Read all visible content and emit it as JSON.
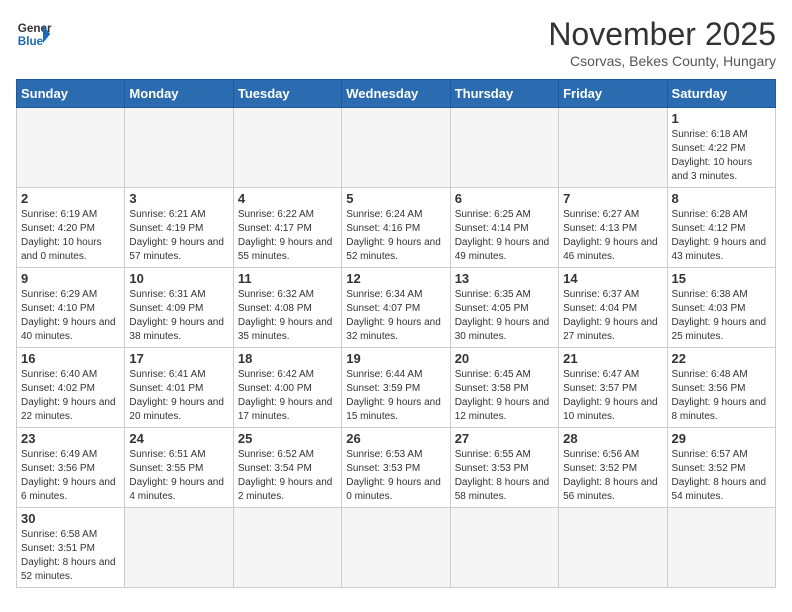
{
  "logo": {
    "text_general": "General",
    "text_blue": "Blue"
  },
  "title": "November 2025",
  "subtitle": "Csorvas, Bekes County, Hungary",
  "weekdays": [
    "Sunday",
    "Monday",
    "Tuesday",
    "Wednesday",
    "Thursday",
    "Friday",
    "Saturday"
  ],
  "weeks": [
    [
      {
        "day": "",
        "info": ""
      },
      {
        "day": "",
        "info": ""
      },
      {
        "day": "",
        "info": ""
      },
      {
        "day": "",
        "info": ""
      },
      {
        "day": "",
        "info": ""
      },
      {
        "day": "",
        "info": ""
      },
      {
        "day": "1",
        "info": "Sunrise: 6:18 AM\nSunset: 4:22 PM\nDaylight: 10 hours and 3 minutes."
      }
    ],
    [
      {
        "day": "2",
        "info": "Sunrise: 6:19 AM\nSunset: 4:20 PM\nDaylight: 10 hours and 0 minutes."
      },
      {
        "day": "3",
        "info": "Sunrise: 6:21 AM\nSunset: 4:19 PM\nDaylight: 9 hours and 57 minutes."
      },
      {
        "day": "4",
        "info": "Sunrise: 6:22 AM\nSunset: 4:17 PM\nDaylight: 9 hours and 55 minutes."
      },
      {
        "day": "5",
        "info": "Sunrise: 6:24 AM\nSunset: 4:16 PM\nDaylight: 9 hours and 52 minutes."
      },
      {
        "day": "6",
        "info": "Sunrise: 6:25 AM\nSunset: 4:14 PM\nDaylight: 9 hours and 49 minutes."
      },
      {
        "day": "7",
        "info": "Sunrise: 6:27 AM\nSunset: 4:13 PM\nDaylight: 9 hours and 46 minutes."
      },
      {
        "day": "8",
        "info": "Sunrise: 6:28 AM\nSunset: 4:12 PM\nDaylight: 9 hours and 43 minutes."
      }
    ],
    [
      {
        "day": "9",
        "info": "Sunrise: 6:29 AM\nSunset: 4:10 PM\nDaylight: 9 hours and 40 minutes."
      },
      {
        "day": "10",
        "info": "Sunrise: 6:31 AM\nSunset: 4:09 PM\nDaylight: 9 hours and 38 minutes."
      },
      {
        "day": "11",
        "info": "Sunrise: 6:32 AM\nSunset: 4:08 PM\nDaylight: 9 hours and 35 minutes."
      },
      {
        "day": "12",
        "info": "Sunrise: 6:34 AM\nSunset: 4:07 PM\nDaylight: 9 hours and 32 minutes."
      },
      {
        "day": "13",
        "info": "Sunrise: 6:35 AM\nSunset: 4:05 PM\nDaylight: 9 hours and 30 minutes."
      },
      {
        "day": "14",
        "info": "Sunrise: 6:37 AM\nSunset: 4:04 PM\nDaylight: 9 hours and 27 minutes."
      },
      {
        "day": "15",
        "info": "Sunrise: 6:38 AM\nSunset: 4:03 PM\nDaylight: 9 hours and 25 minutes."
      }
    ],
    [
      {
        "day": "16",
        "info": "Sunrise: 6:40 AM\nSunset: 4:02 PM\nDaylight: 9 hours and 22 minutes."
      },
      {
        "day": "17",
        "info": "Sunrise: 6:41 AM\nSunset: 4:01 PM\nDaylight: 9 hours and 20 minutes."
      },
      {
        "day": "18",
        "info": "Sunrise: 6:42 AM\nSunset: 4:00 PM\nDaylight: 9 hours and 17 minutes."
      },
      {
        "day": "19",
        "info": "Sunrise: 6:44 AM\nSunset: 3:59 PM\nDaylight: 9 hours and 15 minutes."
      },
      {
        "day": "20",
        "info": "Sunrise: 6:45 AM\nSunset: 3:58 PM\nDaylight: 9 hours and 12 minutes."
      },
      {
        "day": "21",
        "info": "Sunrise: 6:47 AM\nSunset: 3:57 PM\nDaylight: 9 hours and 10 minutes."
      },
      {
        "day": "22",
        "info": "Sunrise: 6:48 AM\nSunset: 3:56 PM\nDaylight: 9 hours and 8 minutes."
      }
    ],
    [
      {
        "day": "23",
        "info": "Sunrise: 6:49 AM\nSunset: 3:56 PM\nDaylight: 9 hours and 6 minutes."
      },
      {
        "day": "24",
        "info": "Sunrise: 6:51 AM\nSunset: 3:55 PM\nDaylight: 9 hours and 4 minutes."
      },
      {
        "day": "25",
        "info": "Sunrise: 6:52 AM\nSunset: 3:54 PM\nDaylight: 9 hours and 2 minutes."
      },
      {
        "day": "26",
        "info": "Sunrise: 6:53 AM\nSunset: 3:53 PM\nDaylight: 9 hours and 0 minutes."
      },
      {
        "day": "27",
        "info": "Sunrise: 6:55 AM\nSunset: 3:53 PM\nDaylight: 8 hours and 58 minutes."
      },
      {
        "day": "28",
        "info": "Sunrise: 6:56 AM\nSunset: 3:52 PM\nDaylight: 8 hours and 56 minutes."
      },
      {
        "day": "29",
        "info": "Sunrise: 6:57 AM\nSunset: 3:52 PM\nDaylight: 8 hours and 54 minutes."
      }
    ],
    [
      {
        "day": "30",
        "info": "Sunrise: 6:58 AM\nSunset: 3:51 PM\nDaylight: 8 hours and 52 minutes."
      },
      {
        "day": "",
        "info": ""
      },
      {
        "day": "",
        "info": ""
      },
      {
        "day": "",
        "info": ""
      },
      {
        "day": "",
        "info": ""
      },
      {
        "day": "",
        "info": ""
      },
      {
        "day": "",
        "info": ""
      }
    ]
  ]
}
